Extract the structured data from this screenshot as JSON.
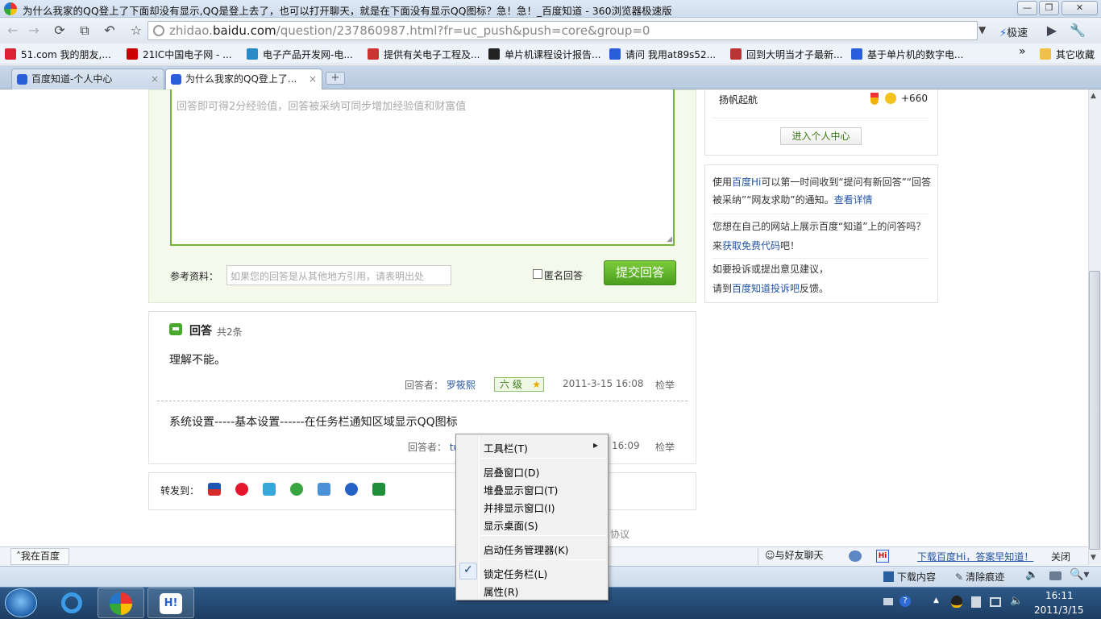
{
  "window": {
    "title": "为什么我家的QQ登上了下面却没有显示,QQ是登上去了，也可以打开聊天，就是在下面没有显示QQ图标？急！急！_百度知道 - 360浏览器极速版",
    "min": "—",
    "max": "❐",
    "close": "✕"
  },
  "address": {
    "domain_pre": "zhidao.",
    "domain": "baidu.com",
    "path": "/question/237860987.html?fr=uc_push&push=core&group=0",
    "speed_label": "极速"
  },
  "bookmarks": [
    {
      "label": "51.com 我的朋友,...",
      "color": "#d23"
    },
    {
      "label": "21IC中国电子网 - ...",
      "color": "#c00"
    },
    {
      "label": "电子产品开发网-电...",
      "color": "#2a8ac8"
    },
    {
      "label": "提供有关电子工程及...",
      "color": "#c33"
    },
    {
      "label": "单片机课程设计报告...",
      "color": "#222"
    },
    {
      "label": "请问 我用at89s52...",
      "color": "#2b5fd9"
    },
    {
      "label": "回到大明当才子最新...",
      "color": "#b33"
    },
    {
      "label": "基于单片机的数字电...",
      "color": "#2b5fd9"
    }
  ],
  "bookmarks_more": "»",
  "other_bookmarks": "其它收藏",
  "tabs": [
    {
      "label": "百度知道-个人中心",
      "close": "×"
    },
    {
      "label": "为什么我家的QQ登上了...",
      "close": "×"
    }
  ],
  "answer_form": {
    "placeholder": "回答即可得2分经验值，回答被采纳可同步增加经验值和财富值",
    "ref_label": "参考资料：",
    "ref_placeholder": "如果您的回答是从其他地方引用，请表明出处",
    "anonymous_label": "匿名回答",
    "submit_label": "提交回答"
  },
  "answers": {
    "title": "回答",
    "count": "共2条",
    "items": [
      {
        "text": "理解不能。",
        "by_label": "回答者：",
        "user": "罗筱熙",
        "level": "六 级",
        "date": "2011-3-15 16:08",
        "report": "检举"
      },
      {
        "text": "系统设置-----基本设置------在任务栏通知区域显示QQ图标",
        "by_label": "回答者：",
        "user": "tu",
        "date": "16:09",
        "report": "检举"
      }
    ]
  },
  "share": {
    "label": "转发到："
  },
  "agreement_partial": "协议",
  "sidebar": {
    "user": "扬帆起航",
    "score": "+660",
    "center_btn": "进入个人中心",
    "hi_pre": "使用",
    "hi_link1": "百度Hi",
    "hi_mid": "可以第一时间收到“提问有新回答”“回答被采纳”“网友求助”的通知。",
    "hi_link2": "查看详情",
    "site_q": "您想在自己的网站上展示百度“知道”上的问答吗？",
    "site_pre": "来",
    "site_link": "获取免费代码",
    "site_post": "吧！",
    "fb_1": "如要投诉或提出意见建议，",
    "fb_pre": "请到",
    "fb_link": "百度知道投诉吧",
    "fb_post": "反馈。"
  },
  "baidu_bar": {
    "left": "我在百度",
    "chat": "与好友聊天",
    "download_hi": "下载百度Hi，答案早知道！",
    "close": "关闭"
  },
  "browser_status": {
    "downloads": "下载内容",
    "clear": "清除痕迹"
  },
  "context_menu": {
    "items": [
      "工具栏(T)",
      "层叠窗口(D)",
      "堆叠显示窗口(T)",
      "并排显示窗口(I)",
      "显示桌面(S)",
      "启动任务管理器(K)",
      "锁定任务栏(L)",
      "属性(R)"
    ],
    "check": "✓",
    "arrow": "▸"
  },
  "clock": {
    "time": "16:11",
    "date": "2011/3/15"
  }
}
